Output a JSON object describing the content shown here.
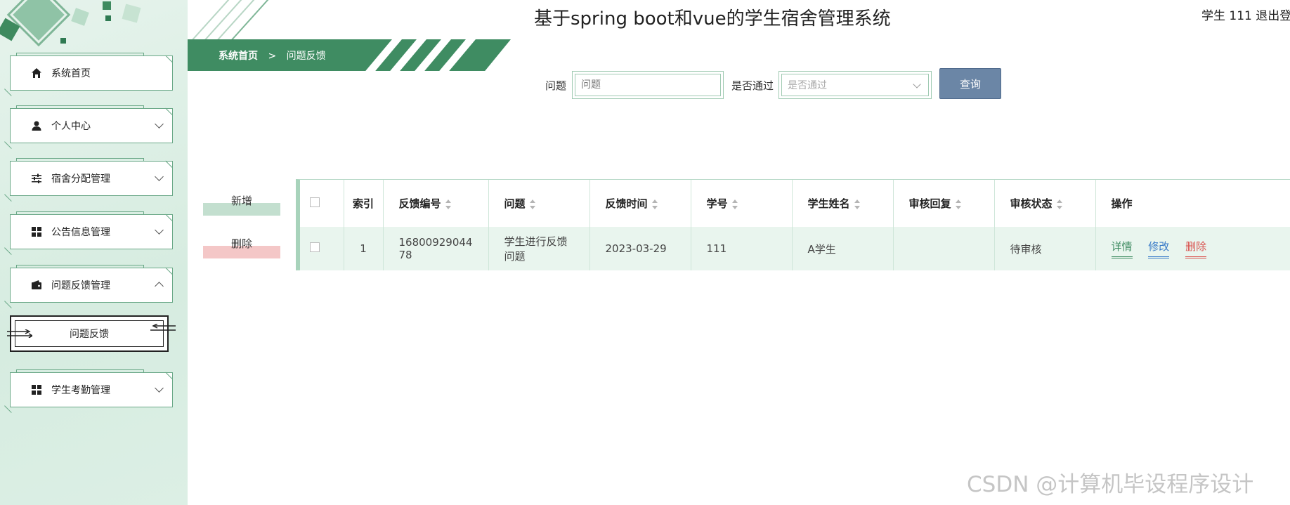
{
  "app": {
    "title": "基于spring boot和vue的学生宿舍管理系统",
    "user_info": "学生 111  退出登"
  },
  "sidebar": {
    "items": [
      {
        "label": "系统首页",
        "icon": "home-icon",
        "expanded": null
      },
      {
        "label": "个人中心",
        "icon": "user-icon",
        "expanded": false
      },
      {
        "label": "宿舍分配管理",
        "icon": "sliders-icon",
        "expanded": false
      },
      {
        "label": "公告信息管理",
        "icon": "grid-icon",
        "expanded": false
      },
      {
        "label": "问题反馈管理",
        "icon": "wallet-icon",
        "expanded": true
      },
      {
        "label": "学生考勤管理",
        "icon": "grid-icon",
        "expanded": false
      }
    ],
    "submenu": {
      "label": "问题反馈"
    }
  },
  "breadcrumb": {
    "home": "系统首页",
    "separator": ">",
    "current": "问题反馈"
  },
  "search": {
    "question_label": "问题",
    "question_placeholder": "问题",
    "passed_label": "是否通过",
    "passed_placeholder": "是否通过",
    "query_button": "查询"
  },
  "actions": {
    "add": "新增",
    "delete": "删除"
  },
  "table": {
    "headers": {
      "index": "索引",
      "feedback_no": "反馈编号",
      "question": "问题",
      "feedback_time": "反馈时间",
      "student_no": "学号",
      "student_name": "学生姓名",
      "review_reply": "审核回复",
      "review_status": "审核状态",
      "operation": "操作"
    },
    "rows": [
      {
        "index": "1",
        "feedback_no": "1680092904478",
        "question": "学生进行反馈问题",
        "feedback_time": "2023-03-29",
        "student_no": "111",
        "student_name": "A学生",
        "review_reply": "",
        "review_status": "待审核",
        "op_detail": "详情",
        "op_edit": "修改",
        "op_delete": "删除"
      }
    ]
  },
  "watermark": "CSDN @计算机毕设程序设计",
  "colors": {
    "primary_green": "#3f8c62",
    "query_button": "#6b86a6",
    "link_edit": "#3a7bc8",
    "link_delete": "#d9534f"
  }
}
